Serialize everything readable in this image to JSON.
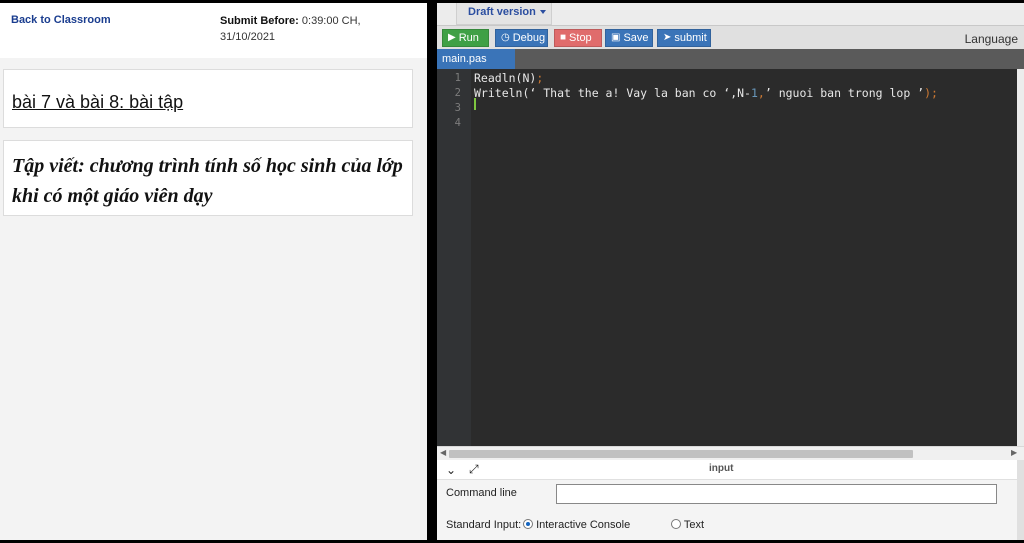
{
  "left": {
    "back_link": "Back to Classroom",
    "submit_label": "Submit Before:",
    "submit_value": " 0:39:00 CH,",
    "submit_date": "31/10/2021",
    "lesson_title": "bài 7 và bài 8: bài tập",
    "task_text": "Tập viết: chương trình tính số học sinh của lớp khi có một giáo viên dạy"
  },
  "editor": {
    "draft_label": "Draft version",
    "buttons": {
      "run": "Run",
      "debug": "Debug",
      "stop": "Stop",
      "save": "Save",
      "submit": "submit"
    },
    "language_label": "Language",
    "file_tab": "main.pas",
    "line_numbers": [
      "1",
      "2",
      "3",
      "4"
    ],
    "code": {
      "l1_a": "Readln(N)",
      "l1_b": ";",
      "l2_a": "Writeln(",
      "l2_b": "‘ That the a! Vay la ban co ‘",
      "l2_c": ",N-",
      "l2_d": "1",
      "l2_e": ",",
      "l2_f": "’ nguoi ban trong lop ’",
      "l2_g": ");"
    }
  },
  "io": {
    "title": "input",
    "cmd_label": "Command line",
    "cmd_value": "",
    "stdin_label": "Standard Input:",
    "option_console": "Interactive Console",
    "option_text": "Text"
  },
  "colors": {
    "run": "#3fa046",
    "debug": "#3a74b8",
    "stop": "#e06c6c",
    "save": "#3a74b8",
    "submit": "#3a74b8"
  }
}
